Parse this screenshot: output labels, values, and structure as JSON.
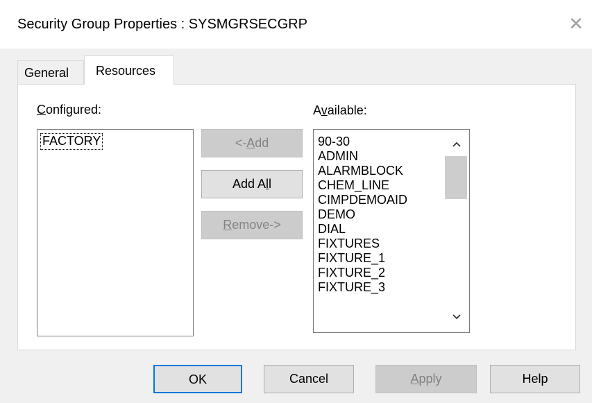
{
  "window": {
    "title": "Security Group Properties : SYSMGRSECGRP",
    "close_glyph": "✕"
  },
  "tabs": [
    {
      "label": "General",
      "active": false
    },
    {
      "label": "Resources",
      "active": true
    }
  ],
  "configured": {
    "label_mnemonic": "C",
    "label_rest": "onfigured:",
    "items": [
      "FACTORY"
    ]
  },
  "available": {
    "label_pre": "A",
    "label_mnemonic": "v",
    "label_rest": "ailable:",
    "items": [
      "90-30",
      "ADMIN",
      "ALARMBLOCK",
      "CHEM_LINE",
      "CIMPDEMOAID",
      "DEMO",
      "DIAL",
      "FIXTURES",
      "FIXTURE_1",
      "FIXTURE_2",
      "FIXTURE_3"
    ],
    "scroll_up_icon": "chevron-up-icon",
    "scroll_down_icon": "chevron-down-icon"
  },
  "middle_buttons": {
    "add_pre": "<-",
    "add_mnemonic": "A",
    "add_rest": "dd",
    "add_enabled": false,
    "addall_pre": "Add A",
    "addall_mnemonic": "l",
    "addall_rest": "l",
    "addall_enabled": true,
    "remove_mnemonic": "R",
    "remove_rest": "emove->",
    "remove_enabled": false
  },
  "footer_buttons": {
    "ok": "OK",
    "cancel": "Cancel",
    "apply_mnemonic": "A",
    "apply_rest": "pply",
    "apply_enabled": false,
    "help": "Help"
  },
  "colors": {
    "default_button_border": "#0078d7",
    "disabled_text": "#838383"
  }
}
